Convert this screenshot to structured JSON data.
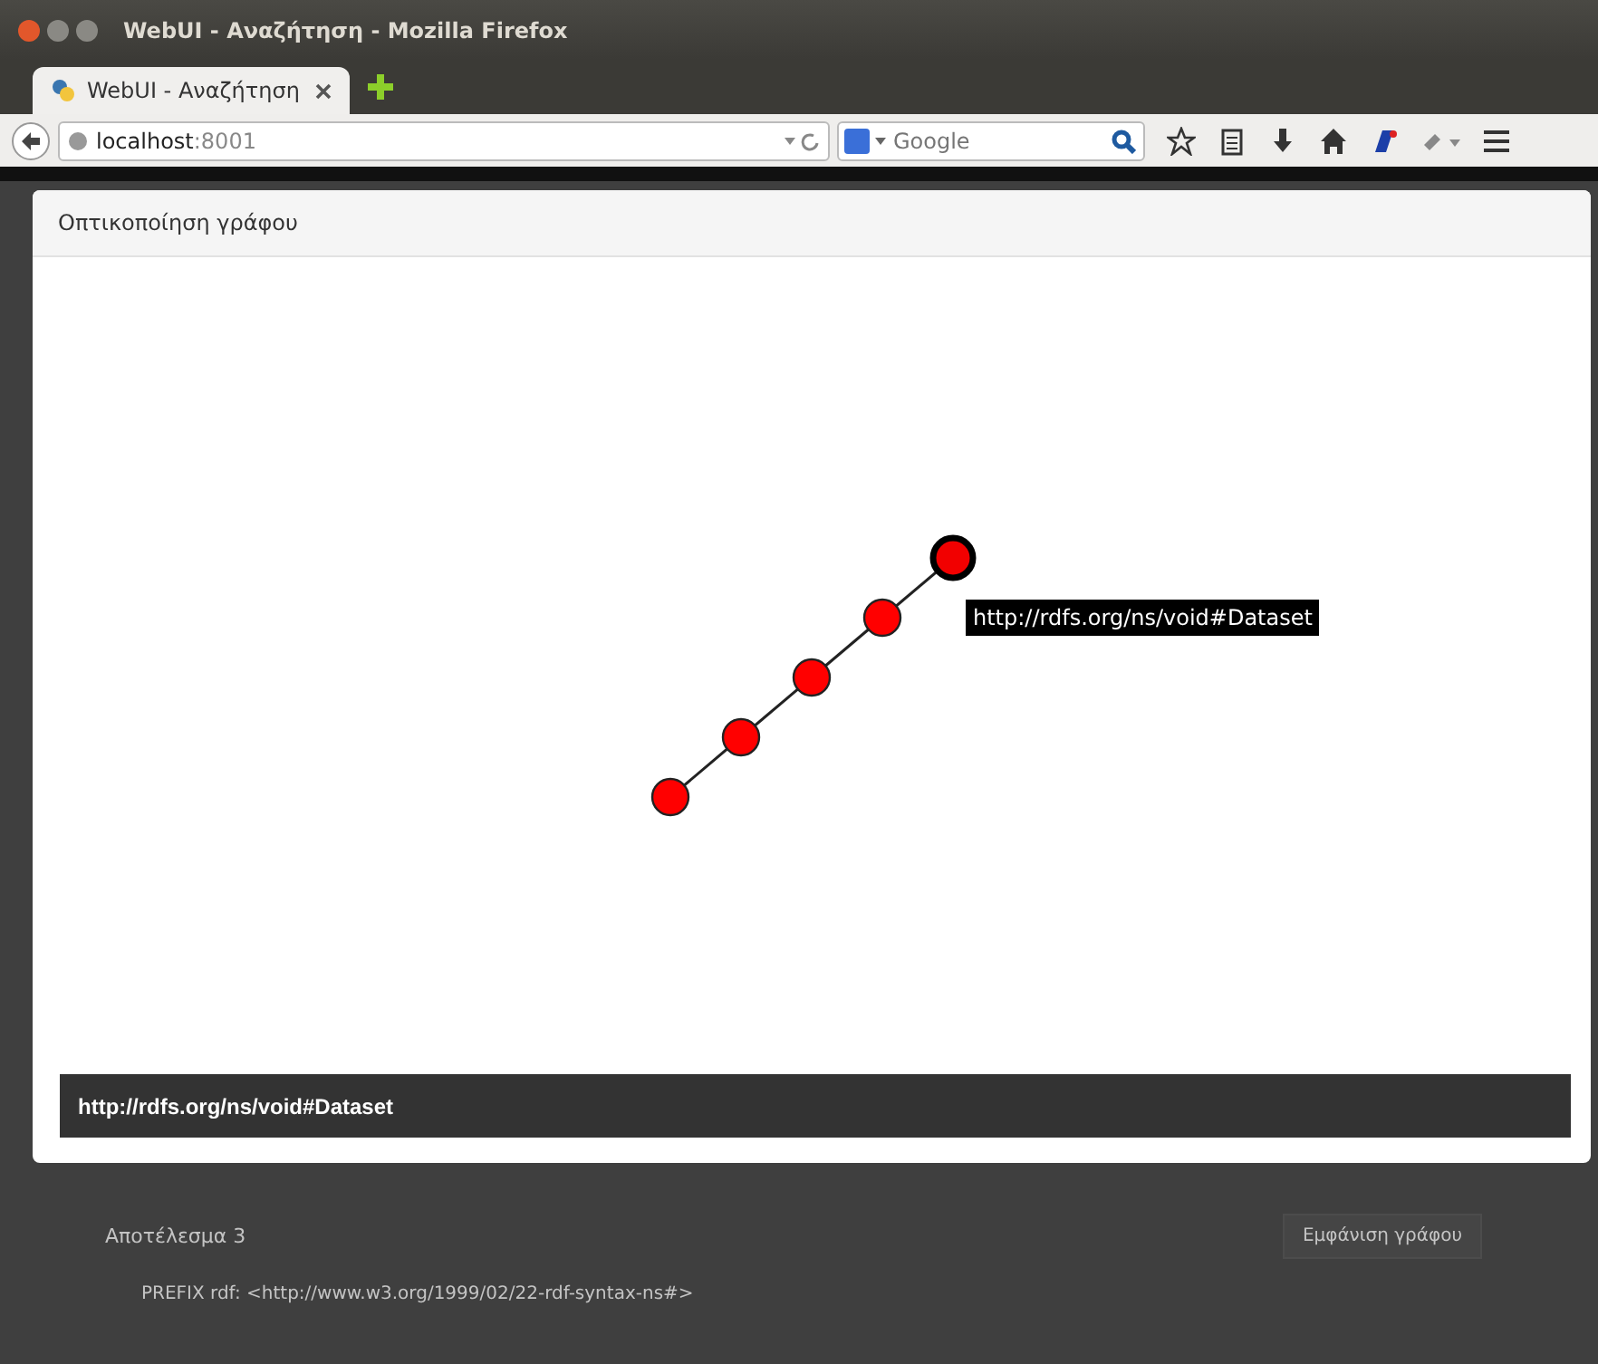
{
  "window": {
    "title": "WebUI - Αναζήτηση - Mozilla Firefox"
  },
  "tabs": [
    {
      "label": "WebUI - Αναζήτηση",
      "selected": true
    }
  ],
  "address_bar": {
    "host": "localhost",
    "port": ":8001"
  },
  "search": {
    "engine_placeholder": "Google"
  },
  "modal": {
    "title": "Οπτικοποίηση γράφου",
    "nodes": [
      {
        "selected": false
      },
      {
        "selected": false
      },
      {
        "selected": false
      },
      {
        "selected": false
      },
      {
        "selected": true
      }
    ],
    "tooltip": "http://rdfs.org/ns/void#Dataset",
    "info_bar": "http://rdfs.org/ns/void#Dataset"
  },
  "background_panel": {
    "title": "Αποτέλεσμα 3",
    "button": "Εμφάνιση γράφου",
    "code_line": "PREFIX rdf: <http://www.w3.org/1999/02/22-rdf-syntax-ns#>"
  }
}
